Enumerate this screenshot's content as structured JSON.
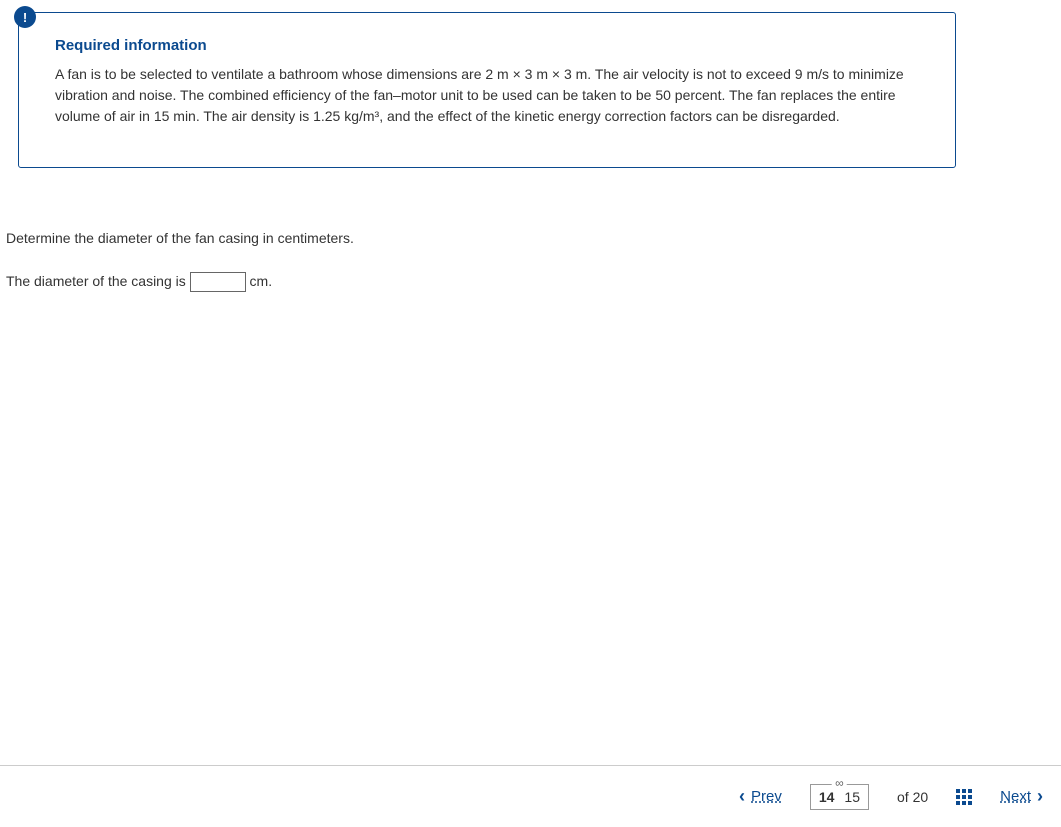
{
  "alert": {
    "symbol": "!"
  },
  "required": {
    "title": "Required information",
    "body": "A fan is to be selected to ventilate a bathroom whose dimensions are 2 m × 3 m × 3 m. The air velocity is not to exceed 9 m/s to minimize vibration and noise. The combined efficiency of the fan–motor unit to be used can be taken to be 50 percent. The fan replaces the entire volume of air in 15 min. The air density is 1.25 kg/m³, and the effect of the kinetic energy correction factors can be disregarded."
  },
  "question": {
    "prompt": "Determine the diameter of the fan casing in centimeters.",
    "answer_prefix": "The diameter of the casing is ",
    "answer_suffix": " cm.",
    "input_value": ""
  },
  "nav": {
    "prev": "Prev",
    "next": "Next",
    "page_current": "14",
    "page_secondary": "15",
    "of_label": "of",
    "total": "20"
  }
}
